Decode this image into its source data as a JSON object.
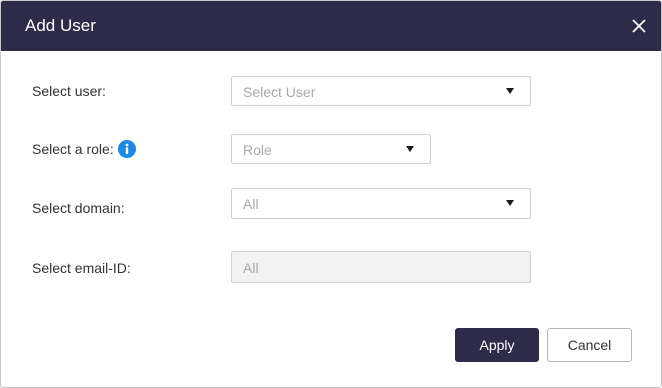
{
  "dialog": {
    "title": "Add User",
    "close_icon": "close-icon"
  },
  "fields": {
    "user": {
      "label": "Select user:",
      "placeholder": "Select User"
    },
    "role": {
      "label": "Select a role:",
      "placeholder": "Role",
      "info_icon": "info-icon"
    },
    "domain": {
      "label": "Select domain:",
      "value": "All"
    },
    "email": {
      "label": "Select email-ID:",
      "value": "All"
    }
  },
  "actions": {
    "apply_label": "Apply",
    "cancel_label": "Cancel"
  },
  "colors": {
    "header": "#2e2a4a",
    "primary_button": "#2e2a4a",
    "info_icon": "#1e88e5"
  }
}
